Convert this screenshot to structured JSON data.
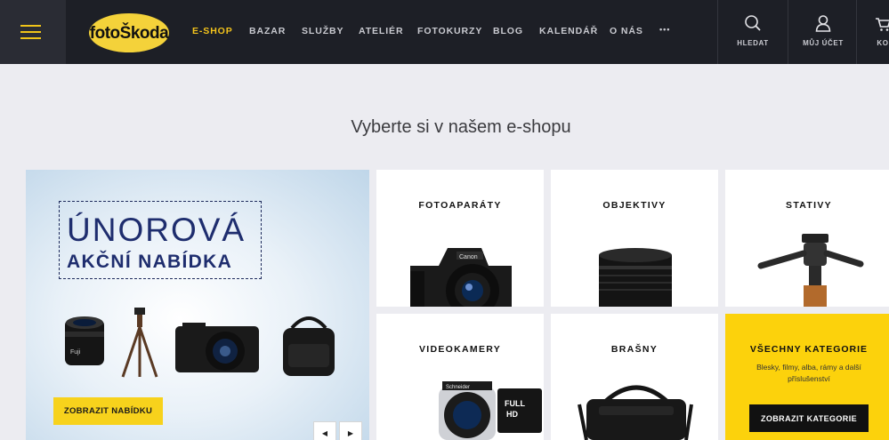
{
  "header": {
    "logo_text": "fotoŠkoda",
    "nav": [
      {
        "label": "E-SHOP",
        "active": true
      },
      {
        "label": "BAZAR"
      },
      {
        "label": "SLUŽBY"
      },
      {
        "label": "ATELIÉR"
      },
      {
        "label": "FOTOKURZY"
      },
      {
        "label": "BLOG"
      },
      {
        "label": "KALENDÁŘ"
      },
      {
        "label": "O NÁS"
      }
    ],
    "more_label": "•••",
    "search_label": "HLEDAT",
    "account_label": "MŮJ ÚČET",
    "cart_label": "KO"
  },
  "section_title": "Vyberte si v našem e-shopu",
  "promo": {
    "title_line1": "ÚNOROVÁ",
    "title_line2": "AKČNÍ NABÍDKA",
    "button_label": "ZOBRAZIT NABÍDKU",
    "prev_label": "◀",
    "next_label": "▶"
  },
  "categories": [
    {
      "label": "FOTOAPARÁTY"
    },
    {
      "label": "OBJEKTIVY"
    },
    {
      "label": "STATIVY"
    },
    {
      "label": "VIDEOKAMERY"
    },
    {
      "label": "BRAŠNY"
    }
  ],
  "all_categories": {
    "label": "VŠECHNY KATEGORIE",
    "description": "Blesky, filmy, alba, rámy a další příslušenství",
    "button_label": "ZOBRAZIT KATEGORIE"
  },
  "colors": {
    "header_bg": "#1d1f26",
    "accent_yellow": "#f3c31c",
    "page_bg": "#ececf1",
    "promo_navy": "#1e2d6e"
  }
}
